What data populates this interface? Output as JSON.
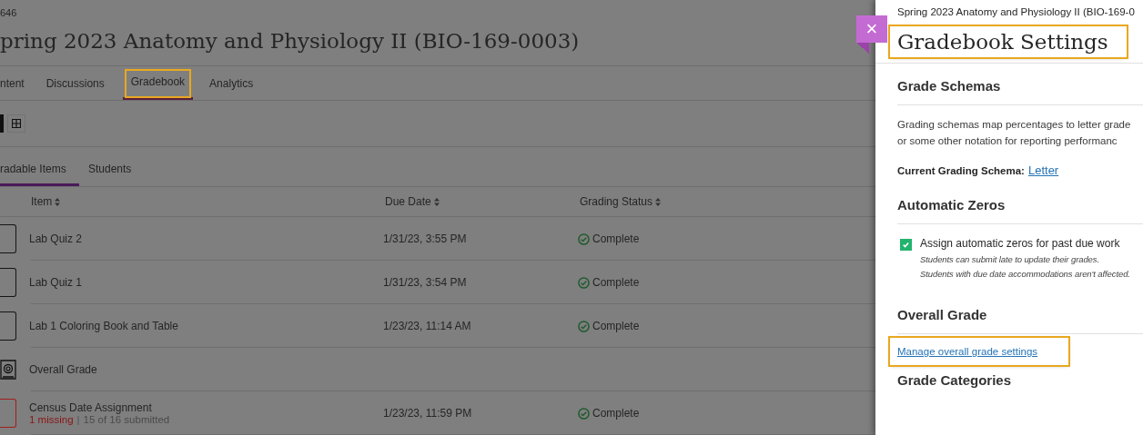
{
  "course_id": "646",
  "course_title": "pring 2023 Anatomy and Physiology II (BIO-169-0003)",
  "tabs": [
    {
      "label": "ntent",
      "selected": false,
      "highlighted": false
    },
    {
      "label": "Discussions",
      "selected": false,
      "highlighted": false
    },
    {
      "label": "Gradebook",
      "selected": true,
      "highlighted": true
    },
    {
      "label": "Analytics",
      "selected": false,
      "highlighted": false
    }
  ],
  "view_toggle": [
    {
      "kind": "list",
      "selected": true
    },
    {
      "kind": "grid",
      "selected": false
    }
  ],
  "subtabs": [
    {
      "label": "radable Items",
      "selected": true
    },
    {
      "label": "Students",
      "selected": false
    }
  ],
  "table": {
    "columns": [
      {
        "label": "Item"
      },
      {
        "label": "Due Date"
      },
      {
        "label": "Grading Status"
      }
    ],
    "rows": [
      {
        "kind": "item",
        "item": "Lab Quiz 2",
        "due": "1/31/23, 3:55 PM",
        "status": "Complete"
      },
      {
        "kind": "item",
        "item": "Lab Quiz 1",
        "due": "1/31/23, 3:54 PM",
        "status": "Complete"
      },
      {
        "kind": "item",
        "item": "Lab 1 Coloring Book and Table",
        "due": "1/23/23, 11:14 AM",
        "status": "Complete"
      },
      {
        "kind": "overall",
        "item": "Overall Grade"
      },
      {
        "kind": "missing",
        "item": "Census Date Assignment",
        "missing": "1 missing",
        "separator": "|",
        "submitted": "15 of 16 submitted",
        "due": "1/23/23, 11:59 PM",
        "status": "Complete"
      }
    ]
  },
  "panel": {
    "course": "Spring 2023 Anatomy and Physiology II (BIO-169-0",
    "title": "Gradebook Settings",
    "title_highlighted": true,
    "close": "×",
    "grade_schemas": {
      "heading": "Grade Schemas",
      "lines": [
        "Grading schemas map percentages to letter grade",
        "or some other notation for reporting performanc"
      ],
      "current_label": "Current Grading Schema:",
      "current_link": "Letter"
    },
    "automatic_zeros": {
      "heading": "Automatic Zeros",
      "label": "Assign automatic zeros for past due work",
      "checked": true,
      "notes": [
        "Students can submit late to update their grades.",
        "Students with due date accommodations aren't affected."
      ]
    },
    "overall_grade": {
      "heading": "Overall Grade",
      "link": "Manage overall grade settings",
      "highlighted": true
    },
    "grade_categories": {
      "heading": "Grade Categories"
    }
  }
}
